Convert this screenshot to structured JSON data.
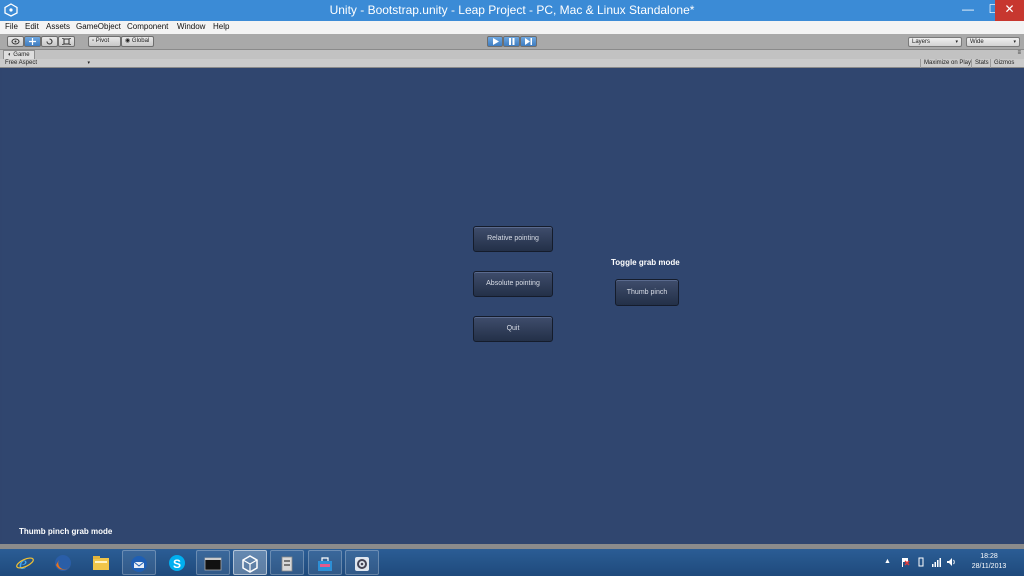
{
  "window": {
    "title": "Unity - Bootstrap.unity - Leap Project - PC, Mac & Linux Standalone*"
  },
  "menu": [
    "File",
    "Edit",
    "Assets",
    "GameObject",
    "Component",
    "Window",
    "Help"
  ],
  "toolbar": {
    "transform_tools": [
      "hand-icon",
      "move-icon",
      "rotate-icon",
      "scale-icon"
    ],
    "pivot_label": "Pivot",
    "global_label": "Global",
    "play_controls": [
      "play-icon",
      "pause-icon",
      "step-icon"
    ],
    "layers_label": "Layers",
    "layout_label": "Wide"
  },
  "game_panel": {
    "tab_label": "Game",
    "aspect_label": "Free Aspect",
    "maximize_label": "Maximize on Play",
    "stats_label": "Stats",
    "gizmos_label": "Gizmos"
  },
  "game_view": {
    "buttons": {
      "relative": "Relative pointing",
      "absolute": "Absolute pointing",
      "quit": "Quit",
      "thumb": "Thumb pinch"
    },
    "toggle_label": "Toggle grab mode",
    "mode_label": "Thumb pinch grab mode"
  },
  "taskbar": {
    "apps": [
      "internet-explorer-icon",
      "firefox-icon",
      "file-explorer-icon",
      "thunderbird-icon",
      "skype-icon",
      "command-prompt-icon",
      "unity-icon",
      "app-installer-icon",
      "app-store-icon",
      "settings-gear-icon"
    ],
    "clock_time": "18:28",
    "clock_date": "28/11/2013"
  },
  "colors": {
    "titlebar": "#3b8bd6",
    "game_bg": "#30466f",
    "taskbar": "#2b5d95",
    "close": "#c7372f"
  }
}
